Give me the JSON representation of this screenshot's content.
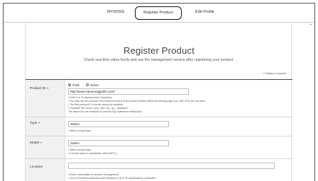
{
  "nav": {
    "mydong": "MYDDNS",
    "register_product": "Register Product",
    "edit_profile": "Edit Profile"
  },
  "scroll_up_glyph": "⌃",
  "header": {
    "title": "Register Product",
    "subtitle": "Check real-time video feeds and use the management service after registering your product.",
    "required_note": "» Display is required."
  },
  "form": {
    "product_id": {
      "label": "Product ID »",
      "radio_options": [
        "iPolis",
        "DDNS"
      ],
      "selected": "iPolis",
      "value": "http://www.samsungipolis.com/",
      "help": [
        "• Enter 4 to 22 alphanumeric characters.",
        "• You may use the services if the entered product ID and product frame within the settings page (e.g. SNC-570) are the same.",
        "• The first product ID to be set cannot be modified.",
        "• Unusable IDs: union, drop, exec, sp_, xp_, sysobject",
        "   The above IDs are restricted to prevent SQL statement malfunction."
      ]
    },
    "type": {
      "label": "Type »",
      "select_value": "Select",
      "help": [
        "• Select product type."
      ]
    },
    "model": {
      "label": "Model »",
      "select_value": "Select",
      "help": [
        "• Select product type.",
        "• If model name is unavailable, select [ETC.]."
      ]
    },
    "location": {
      "label": "Location",
      "value": "",
      "help": [
        "• Enter a description for product management.",
        "• Up to 15 Korean characters and numbers or up to 30 alphanumeric characters."
      ]
    }
  }
}
